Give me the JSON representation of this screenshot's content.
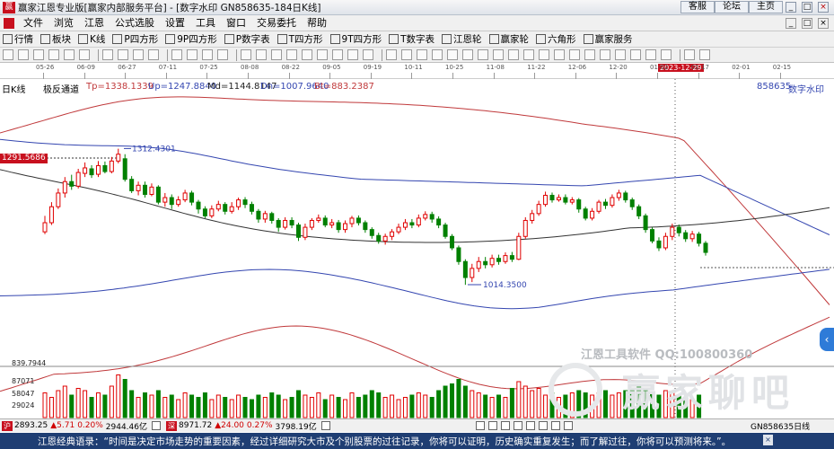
{
  "window": {
    "title": "赢家江恩专业版[赢家内部服务平台] - [数字水印  GN858635-184日K线]",
    "links": [
      "客服",
      "论坛",
      "主页"
    ],
    "controls": [
      "_",
      "□",
      "×"
    ]
  },
  "menu": {
    "items": [
      "文件",
      "浏览",
      "江恩",
      "公式选股",
      "设置",
      "工具",
      "窗口",
      "交易委托",
      "帮助"
    ],
    "sub_controls": [
      "_",
      "□",
      "×"
    ]
  },
  "toolbar1": {
    "items": [
      {
        "icon": "grid-icon",
        "label": "行情"
      },
      {
        "icon": "block-icon",
        "label": "板块"
      },
      {
        "icon": "kline-icon",
        "label": "K线"
      },
      {
        "icon": "p-icon",
        "label": "P四方形"
      },
      {
        "icon": "nine-icon",
        "label": "9P四方形"
      },
      {
        "icon": "p-icon",
        "label": "P数字表"
      },
      {
        "icon": "t-icon",
        "label": "T四方形"
      },
      {
        "icon": "nine-icon",
        "label": "9T四方形"
      },
      {
        "icon": "t-icon",
        "label": "T数字表"
      },
      {
        "icon": "wheel-icon",
        "label": "江恩轮"
      },
      {
        "icon": "wheel-icon",
        "label": "赢家轮"
      },
      {
        "icon": "hexagon-icon",
        "label": "六角形"
      },
      {
        "icon": "service-icon",
        "label": "赢家服务"
      }
    ]
  },
  "toolbar2": {
    "icons": [
      "view-icon",
      "pointer-icon",
      "hand-icon",
      "cross-icon",
      "zero-icon",
      "chevron-icon",
      "eye-icon",
      "save-icon",
      "lock-icon",
      "key-icon",
      "first-icon",
      "prev-icon",
      "next-icon",
      "last-icon",
      "pin-icon",
      "pin-icon",
      "pin-icon",
      "pin-icon",
      "pin-icon",
      "pin-icon",
      "pin-icon",
      "pin-icon",
      "pin-icon",
      "hand-icon",
      "draw-icon",
      "draw-icon",
      "draw-icon",
      "draw-icon",
      "draw-icon",
      "draw-icon",
      "draw-icon",
      "draw-icon",
      "draw-icon",
      "draw-icon",
      "draw-icon",
      "draw-icon",
      "draw-icon",
      "draw-icon",
      "draw-icon",
      "draw-icon",
      "draw-icon",
      "draw-icon",
      "record-icon",
      "link-icon"
    ]
  },
  "ruler": {
    "dates": [
      "05-26",
      "06-09",
      "06-27",
      "07-11",
      "07-25",
      "08-08",
      "08-22",
      "09-05",
      "09-19",
      "10-11",
      "10-25",
      "11-08",
      "11-22",
      "12-06",
      "12-20",
      "01-02",
      "01-17",
      "02-01",
      "02-15"
    ],
    "cursor_date": "2023-12-29"
  },
  "chart": {
    "period_label": "日K线",
    "indicator_name": "极反通道",
    "tp": "Tp=1338.1339",
    "up": "Up=1247.8840",
    "md": "Md=1144.8147",
    "dn": "Dn=1007.9640",
    "bt": "Bt=883.2387",
    "code": "858635",
    "watermark_label": "数字水印",
    "left_price": "1291.5686",
    "high_label": "1312.4301",
    "low_label": "1014.3500",
    "volume": {
      "max_label": "839.7944",
      "ticks": [
        "87071",
        "58047",
        "29024"
      ]
    },
    "watermark_text": "江恩工具软件  QQ:100800360",
    "watermark_big": "赢家聊吧",
    "colors": {
      "up": "#e00000",
      "down": "#008000",
      "tp": "#c0393b",
      "up_band": "#3446b0",
      "mid": "#333333"
    }
  },
  "chart_data": {
    "type": "candlestick",
    "title": "数字水印 日K线",
    "period": "日K线",
    "ylim": [
      850,
      1400
    ],
    "indicator": {
      "name": "极反通道",
      "Tp": 1338.1339,
      "Up": 1247.884,
      "Md": 1144.8147,
      "Dn": 1007.964,
      "Bt": 883.2387
    },
    "annotations": {
      "high": 1312.4301,
      "low": 1014.35,
      "left_price": 1291.5686
    },
    "volume_ticks": [
      87071,
      58047,
      29024
    ],
    "volume_max": 839.7944,
    "candles": [
      {
        "o": 1130,
        "c": 1150,
        "h": 1165,
        "l": 1125
      },
      {
        "o": 1150,
        "c": 1185,
        "h": 1195,
        "l": 1145
      },
      {
        "o": 1185,
        "c": 1215,
        "h": 1225,
        "l": 1180
      },
      {
        "o": 1215,
        "c": 1240,
        "h": 1250,
        "l": 1205
      },
      {
        "o": 1240,
        "c": 1230,
        "h": 1255,
        "l": 1222
      },
      {
        "o": 1230,
        "c": 1260,
        "h": 1268,
        "l": 1225
      },
      {
        "o": 1258,
        "c": 1270,
        "h": 1282,
        "l": 1250
      },
      {
        "o": 1268,
        "c": 1255,
        "h": 1276,
        "l": 1248
      },
      {
        "o": 1256,
        "c": 1275,
        "h": 1285,
        "l": 1250
      },
      {
        "o": 1275,
        "c": 1262,
        "h": 1284,
        "l": 1258
      },
      {
        "o": 1262,
        "c": 1285,
        "h": 1294,
        "l": 1258
      },
      {
        "o": 1285,
        "c": 1300,
        "h": 1312,
        "l": 1280
      },
      {
        "o": 1290,
        "c": 1245,
        "h": 1300,
        "l": 1240
      },
      {
        "o": 1245,
        "c": 1220,
        "h": 1252,
        "l": 1215
      },
      {
        "o": 1220,
        "c": 1232,
        "h": 1240,
        "l": 1210
      },
      {
        "o": 1232,
        "c": 1212,
        "h": 1240,
        "l": 1205
      },
      {
        "o": 1212,
        "c": 1228,
        "h": 1236,
        "l": 1208
      },
      {
        "o": 1228,
        "c": 1195,
        "h": 1232,
        "l": 1190
      },
      {
        "o": 1195,
        "c": 1205,
        "h": 1215,
        "l": 1185
      },
      {
        "o": 1205,
        "c": 1190,
        "h": 1212,
        "l": 1180
      },
      {
        "o": 1190,
        "c": 1200,
        "h": 1208,
        "l": 1185
      },
      {
        "o": 1200,
        "c": 1215,
        "h": 1222,
        "l": 1195
      },
      {
        "o": 1215,
        "c": 1195,
        "h": 1220,
        "l": 1188
      },
      {
        "o": 1195,
        "c": 1180,
        "h": 1200,
        "l": 1170
      },
      {
        "o": 1180,
        "c": 1165,
        "h": 1186,
        "l": 1160
      },
      {
        "o": 1165,
        "c": 1180,
        "h": 1188,
        "l": 1160
      },
      {
        "o": 1180,
        "c": 1190,
        "h": 1198,
        "l": 1175
      },
      {
        "o": 1190,
        "c": 1175,
        "h": 1195,
        "l": 1168
      },
      {
        "o": 1175,
        "c": 1185,
        "h": 1195,
        "l": 1170
      },
      {
        "o": 1185,
        "c": 1200,
        "h": 1205,
        "l": 1178
      },
      {
        "o": 1200,
        "c": 1190,
        "h": 1206,
        "l": 1182
      },
      {
        "o": 1190,
        "c": 1175,
        "h": 1196,
        "l": 1168
      },
      {
        "o": 1175,
        "c": 1158,
        "h": 1180,
        "l": 1150
      },
      {
        "o": 1158,
        "c": 1170,
        "h": 1176,
        "l": 1150
      },
      {
        "o": 1170,
        "c": 1155,
        "h": 1174,
        "l": 1148
      },
      {
        "o": 1155,
        "c": 1140,
        "h": 1160,
        "l": 1130
      },
      {
        "o": 1140,
        "c": 1155,
        "h": 1162,
        "l": 1135
      },
      {
        "o": 1155,
        "c": 1145,
        "h": 1162,
        "l": 1138
      },
      {
        "o": 1145,
        "c": 1118,
        "h": 1150,
        "l": 1110
      },
      {
        "o": 1118,
        "c": 1140,
        "h": 1148,
        "l": 1112
      },
      {
        "o": 1140,
        "c": 1155,
        "h": 1160,
        "l": 1134
      },
      {
        "o": 1155,
        "c": 1160,
        "h": 1168,
        "l": 1150
      },
      {
        "o": 1160,
        "c": 1145,
        "h": 1166,
        "l": 1140
      },
      {
        "o": 1145,
        "c": 1150,
        "h": 1158,
        "l": 1138
      },
      {
        "o": 1150,
        "c": 1135,
        "h": 1156,
        "l": 1128
      },
      {
        "o": 1135,
        "c": 1148,
        "h": 1155,
        "l": 1128
      },
      {
        "o": 1148,
        "c": 1160,
        "h": 1165,
        "l": 1140
      },
      {
        "o": 1160,
        "c": 1150,
        "h": 1166,
        "l": 1144
      },
      {
        "o": 1150,
        "c": 1135,
        "h": 1155,
        "l": 1128
      },
      {
        "o": 1135,
        "c": 1122,
        "h": 1140,
        "l": 1115
      },
      {
        "o": 1122,
        "c": 1110,
        "h": 1128,
        "l": 1104
      },
      {
        "o": 1110,
        "c": 1120,
        "h": 1126,
        "l": 1102
      },
      {
        "o": 1120,
        "c": 1130,
        "h": 1136,
        "l": 1112
      },
      {
        "o": 1130,
        "c": 1140,
        "h": 1148,
        "l": 1125
      },
      {
        "o": 1140,
        "c": 1150,
        "h": 1158,
        "l": 1134
      },
      {
        "o": 1150,
        "c": 1145,
        "h": 1158,
        "l": 1138
      },
      {
        "o": 1145,
        "c": 1160,
        "h": 1168,
        "l": 1140
      },
      {
        "o": 1160,
        "c": 1168,
        "h": 1175,
        "l": 1155
      },
      {
        "o": 1168,
        "c": 1158,
        "h": 1174,
        "l": 1150
      },
      {
        "o": 1158,
        "c": 1145,
        "h": 1164,
        "l": 1138
      },
      {
        "o": 1145,
        "c": 1120,
        "h": 1150,
        "l": 1115
      },
      {
        "o": 1120,
        "c": 1095,
        "h": 1125,
        "l": 1090
      },
      {
        "o": 1095,
        "c": 1065,
        "h": 1100,
        "l": 1058
      },
      {
        "o": 1065,
        "c": 1030,
        "h": 1070,
        "l": 1014
      },
      {
        "o": 1030,
        "c": 1050,
        "h": 1060,
        "l": 1020
      },
      {
        "o": 1050,
        "c": 1065,
        "h": 1075,
        "l": 1042
      },
      {
        "o": 1065,
        "c": 1058,
        "h": 1075,
        "l": 1050
      },
      {
        "o": 1058,
        "c": 1072,
        "h": 1080,
        "l": 1052
      },
      {
        "o": 1072,
        "c": 1065,
        "h": 1080,
        "l": 1058
      },
      {
        "o": 1065,
        "c": 1078,
        "h": 1085,
        "l": 1060
      },
      {
        "o": 1078,
        "c": 1070,
        "h": 1086,
        "l": 1064
      },
      {
        "o": 1070,
        "c": 1120,
        "h": 1128,
        "l": 1068
      },
      {
        "o": 1120,
        "c": 1155,
        "h": 1162,
        "l": 1115
      },
      {
        "o": 1155,
        "c": 1170,
        "h": 1178,
        "l": 1148
      },
      {
        "o": 1170,
        "c": 1190,
        "h": 1198,
        "l": 1165
      },
      {
        "o": 1190,
        "c": 1210,
        "h": 1218,
        "l": 1185
      },
      {
        "o": 1210,
        "c": 1200,
        "h": 1216,
        "l": 1194
      },
      {
        "o": 1200,
        "c": 1205,
        "h": 1212,
        "l": 1196
      },
      {
        "o": 1205,
        "c": 1195,
        "h": 1212,
        "l": 1190
      },
      {
        "o": 1195,
        "c": 1200,
        "h": 1206,
        "l": 1190
      },
      {
        "o": 1200,
        "c": 1180,
        "h": 1204,
        "l": 1172
      },
      {
        "o": 1180,
        "c": 1160,
        "h": 1185,
        "l": 1155
      },
      {
        "o": 1160,
        "c": 1175,
        "h": 1182,
        "l": 1155
      },
      {
        "o": 1175,
        "c": 1195,
        "h": 1200,
        "l": 1170
      },
      {
        "o": 1195,
        "c": 1188,
        "h": 1202,
        "l": 1180
      },
      {
        "o": 1188,
        "c": 1205,
        "h": 1212,
        "l": 1183
      },
      {
        "o": 1205,
        "c": 1215,
        "h": 1222,
        "l": 1198
      },
      {
        "o": 1215,
        "c": 1200,
        "h": 1220,
        "l": 1194
      },
      {
        "o": 1200,
        "c": 1185,
        "h": 1205,
        "l": 1178
      },
      {
        "o": 1185,
        "c": 1165,
        "h": 1190,
        "l": 1158
      },
      {
        "o": 1165,
        "c": 1135,
        "h": 1170,
        "l": 1128
      },
      {
        "o": 1135,
        "c": 1110,
        "h": 1140,
        "l": 1105
      },
      {
        "o": 1110,
        "c": 1095,
        "h": 1118,
        "l": 1088
      },
      {
        "o": 1095,
        "c": 1120,
        "h": 1128,
        "l": 1090
      },
      {
        "o": 1120,
        "c": 1140,
        "h": 1148,
        "l": 1112
      },
      {
        "o": 1140,
        "c": 1128,
        "h": 1146,
        "l": 1120
      },
      {
        "o": 1128,
        "c": 1115,
        "h": 1134,
        "l": 1108
      },
      {
        "o": 1115,
        "c": 1125,
        "h": 1132,
        "l": 1108
      },
      {
        "o": 1125,
        "c": 1105,
        "h": 1130,
        "l": 1098
      },
      {
        "o": 1105,
        "c": 1085,
        "h": 1110,
        "l": 1078
      }
    ],
    "volume": [
      0.55,
      0.45,
      0.6,
      0.7,
      0.5,
      0.65,
      0.6,
      0.45,
      0.55,
      0.5,
      0.7,
      0.95,
      0.85,
      0.6,
      0.45,
      0.55,
      0.5,
      0.6,
      0.45,
      0.5,
      0.4,
      0.55,
      0.5,
      0.45,
      0.55,
      0.4,
      0.5,
      0.45,
      0.4,
      0.5,
      0.45,
      0.4,
      0.5,
      0.45,
      0.55,
      0.5,
      0.4,
      0.45,
      0.6,
      0.5,
      0.45,
      0.55,
      0.4,
      0.5,
      0.45,
      0.4,
      0.55,
      0.45,
      0.5,
      0.6,
      0.55,
      0.45,
      0.5,
      0.4,
      0.45,
      0.5,
      0.55,
      0.5,
      0.45,
      0.6,
      0.7,
      0.75,
      0.85,
      0.7,
      0.6,
      0.55,
      0.5,
      0.45,
      0.5,
      0.45,
      0.65,
      0.8,
      0.7,
      0.6,
      0.65,
      0.5,
      0.55,
      0.45,
      0.5,
      0.55,
      0.6,
      0.55,
      0.5,
      0.55,
      0.6,
      0.5,
      0.55,
      0.6,
      0.65,
      0.7,
      0.6,
      0.55,
      0.5,
      0.6,
      0.55,
      0.5,
      0.45,
      0.4,
      0.5
    ]
  },
  "status": {
    "idx1_code": "沪",
    "idx1_value": "2893.25",
    "idx1_change": "▲5.71",
    "idx1_pct": "0.20%",
    "idx1_amount": "2944.46亿",
    "idx2_code": "深",
    "idx2_value": "8971.72",
    "idx2_change": "▲24.00",
    "idx2_pct": "0.27%",
    "idx2_amount": "3798.19亿",
    "right_label": "GN858635日线"
  },
  "quote": {
    "text": "江恩经典语录：“时间是决定市场走势的重要因素，经过详细研究大市及个别股票的过往记录，你将可以证明，历史确实重复发生；而了解过往，你将可以预测将来。”。",
    "button": "×"
  }
}
